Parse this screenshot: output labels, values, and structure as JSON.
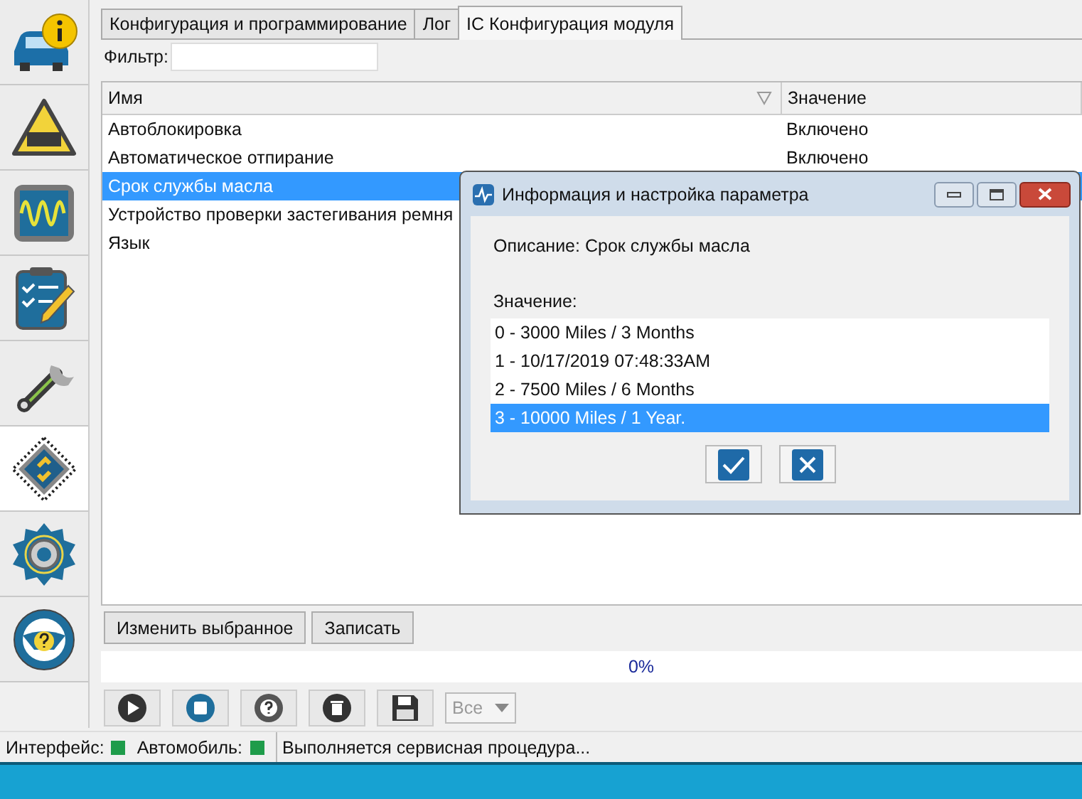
{
  "sidebar": {
    "items": [
      {
        "kind": "car-info",
        "selected": false
      },
      {
        "kind": "dtc",
        "selected": false
      },
      {
        "kind": "scope",
        "selected": false
      },
      {
        "kind": "checklist",
        "selected": false
      },
      {
        "kind": "wrench",
        "selected": false
      },
      {
        "kind": "chip",
        "selected": true
      },
      {
        "kind": "gear",
        "selected": false
      },
      {
        "kind": "help-wheel",
        "selected": false
      }
    ]
  },
  "tabs": [
    {
      "label": "Конфигурация и программирование",
      "selected": false
    },
    {
      "label": "Лог",
      "selected": false
    },
    {
      "label": "IC Конфигурация модуля",
      "selected": true
    }
  ],
  "filter": {
    "label": "Фильтр:"
  },
  "table": {
    "columns": [
      "Имя",
      "Значение"
    ],
    "rows": [
      {
        "name": "Автоблокировка",
        "value": "Включено",
        "selected": false
      },
      {
        "name": "Автоматическое отпирание",
        "value": "Включено",
        "selected": false
      },
      {
        "name": "Срок службы масла",
        "selected": true
      },
      {
        "name": "Устройство проверки застегивания ремня",
        "selected": false
      },
      {
        "name": "Язык",
        "selected": false
      }
    ]
  },
  "buttons": [
    "Изменить выбранное",
    "Записать"
  ],
  "progress": {
    "level": 0,
    "text": "0%"
  },
  "toolbar": {
    "buttons": [
      {
        "kind": "play"
      },
      {
        "kind": "stop"
      },
      {
        "kind": "help"
      },
      {
        "kind": "delete"
      },
      {
        "kind": "save"
      }
    ],
    "dropdown": {
      "value": "Все",
      "disabled": true
    }
  },
  "status_bar": {
    "indicators": [
      {
        "label": "Интерфейс:",
        "color": "#1e9c4a"
      },
      {
        "label": "Автомобиль:",
        "color": "#1e9c4a"
      }
    ],
    "message": "Выполняется сервисная процедура..."
  },
  "dialog": {
    "title": "Информация и настройка параметра",
    "description": "Описание: Срок службы масла",
    "value_label": "Значение:",
    "options": [
      {
        "text": "0 - 3000 Miles / 3 Months",
        "selected": false
      },
      {
        "text": "1 - 10/17/2019 07:48:33AM",
        "selected": false
      },
      {
        "text": "2 - 7500 Miles / 6 Months",
        "selected": false
      },
      {
        "text": "3 - 10000 Miles / 1 Year.",
        "selected": true
      }
    ],
    "buttons": [
      {
        "kind": "ok"
      },
      {
        "kind": "cancel"
      }
    ]
  }
}
